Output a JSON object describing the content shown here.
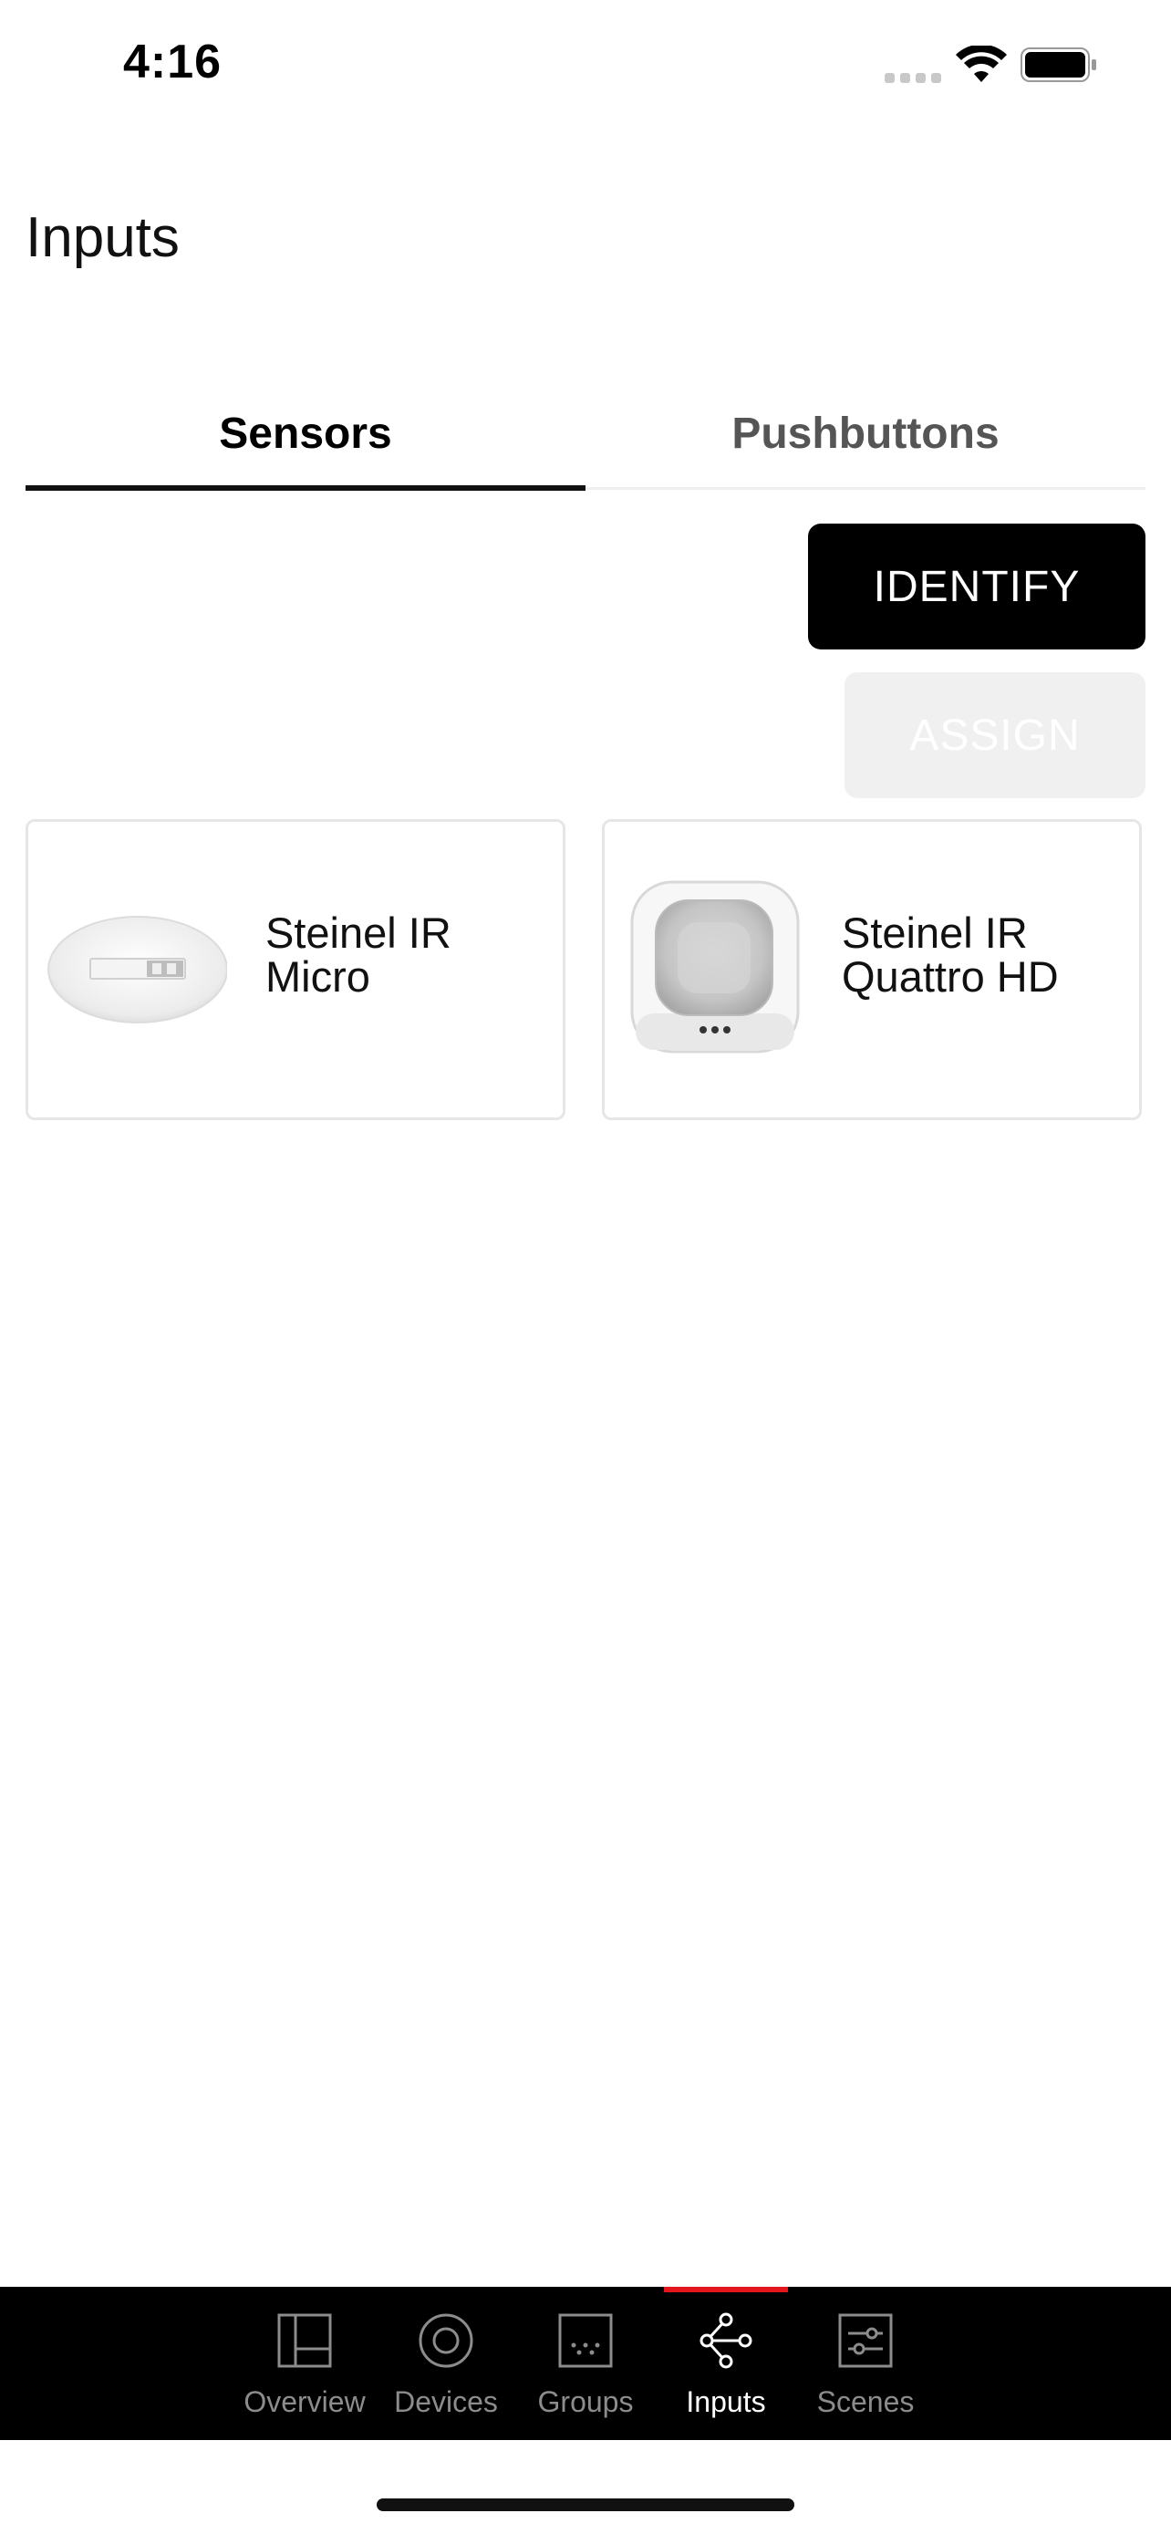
{
  "status_bar": {
    "time": "4:16"
  },
  "page": {
    "title": "Inputs"
  },
  "tabs": [
    {
      "label": "Sensors",
      "active": true
    },
    {
      "label": "Pushbuttons",
      "active": false
    }
  ],
  "actions": {
    "identify_label": "IDENTIFY",
    "assign_label": "ASSIGN"
  },
  "sensors": [
    {
      "name": "Steinel IR Micro",
      "icon": "ceiling-sensor-flat-image"
    },
    {
      "name": "Steinel IR Quattro HD",
      "icon": "ceiling-sensor-square-image"
    }
  ],
  "bottom_nav": {
    "items": [
      {
        "label": "Overview",
        "icon": "layout-panel-icon"
      },
      {
        "label": "Devices",
        "icon": "target-circle-icon"
      },
      {
        "label": "Groups",
        "icon": "dotted-square-icon"
      },
      {
        "label": "Inputs",
        "icon": "share-nodes-icon",
        "active": true
      },
      {
        "label": "Scenes",
        "icon": "sliders-icon"
      }
    ]
  },
  "colors": {
    "accent": "#e3161e",
    "primary": "#000000",
    "disabled_bg": "#f0f0f0"
  }
}
